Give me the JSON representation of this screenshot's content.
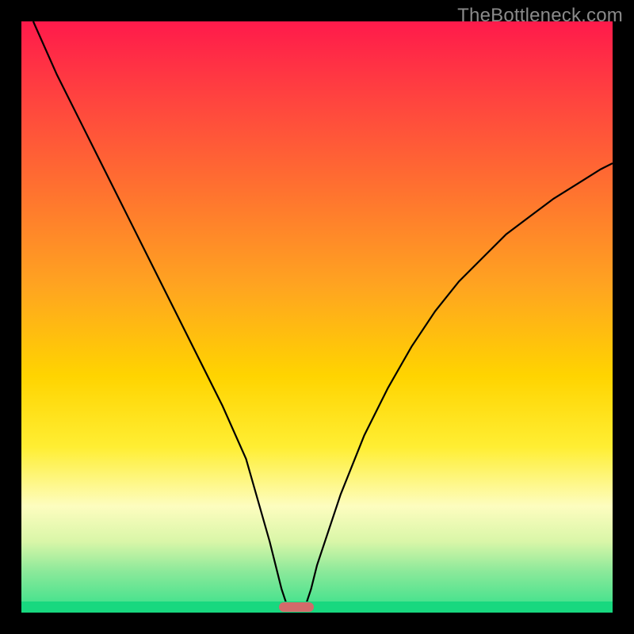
{
  "watermark": "TheBottleneck.com",
  "chart_data": {
    "type": "line",
    "title": "",
    "xlabel": "",
    "ylabel": "",
    "xlim": [
      0,
      100
    ],
    "ylim": [
      0,
      100
    ],
    "series": [
      {
        "name": "curve",
        "x": [
          2,
          6,
          10,
          14,
          18,
          22,
          26,
          30,
          34,
          38,
          42,
          43,
          44,
          45,
          46,
          47,
          48,
          49,
          50,
          54,
          58,
          62,
          66,
          70,
          74,
          78,
          82,
          86,
          90,
          94,
          98,
          100
        ],
        "y": [
          100,
          91,
          83,
          75,
          67,
          59,
          51,
          43,
          35,
          26,
          12,
          8,
          4,
          1,
          0,
          0,
          1,
          4,
          8,
          20,
          30,
          38,
          45,
          51,
          56,
          60,
          64,
          67,
          70,
          72.5,
          75,
          76
        ]
      }
    ],
    "annotations": [
      {
        "type": "marker",
        "x_range": [
          43.5,
          49.5
        ],
        "y": 0,
        "color": "#d36a6a"
      }
    ],
    "gradient_stops": [
      {
        "pos": 0,
        "color": "#ff1a4b"
      },
      {
        "pos": 60,
        "color": "#ffd400"
      },
      {
        "pos": 82,
        "color": "#fdfdbf"
      },
      {
        "pos": 100,
        "color": "#18d87f"
      }
    ]
  },
  "marker": {
    "left_pct": 43.5,
    "width_pct": 6.0
  }
}
